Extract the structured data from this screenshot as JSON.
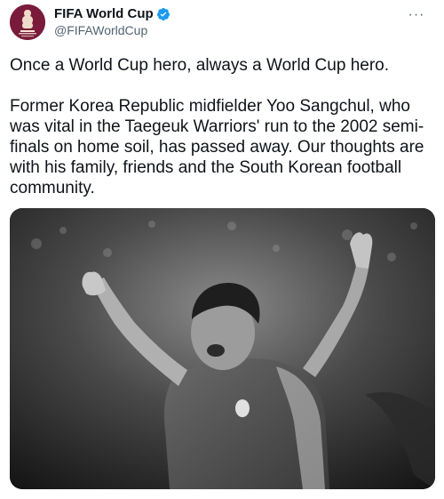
{
  "tweet": {
    "display_name": "FIFA World Cup",
    "handle": "@FIFAWorldCup",
    "verified_icon": "verified-badge-icon",
    "more_label": "···",
    "paragraphs": [
      "Once a World Cup hero, always a World Cup hero.",
      "Former Korea Republic midfielder Yoo Sangchul, who was vital in the Taegeuk Warriors' run to the 2002 semi-finals on home soil, has passed away. Our thoughts are with his family, friends and the South Korean football community."
    ],
    "colors": {
      "avatar_bg": "#7a1b3b",
      "verified": "#1d9bf0",
      "text": "#0f1419",
      "muted": "#536471"
    }
  }
}
